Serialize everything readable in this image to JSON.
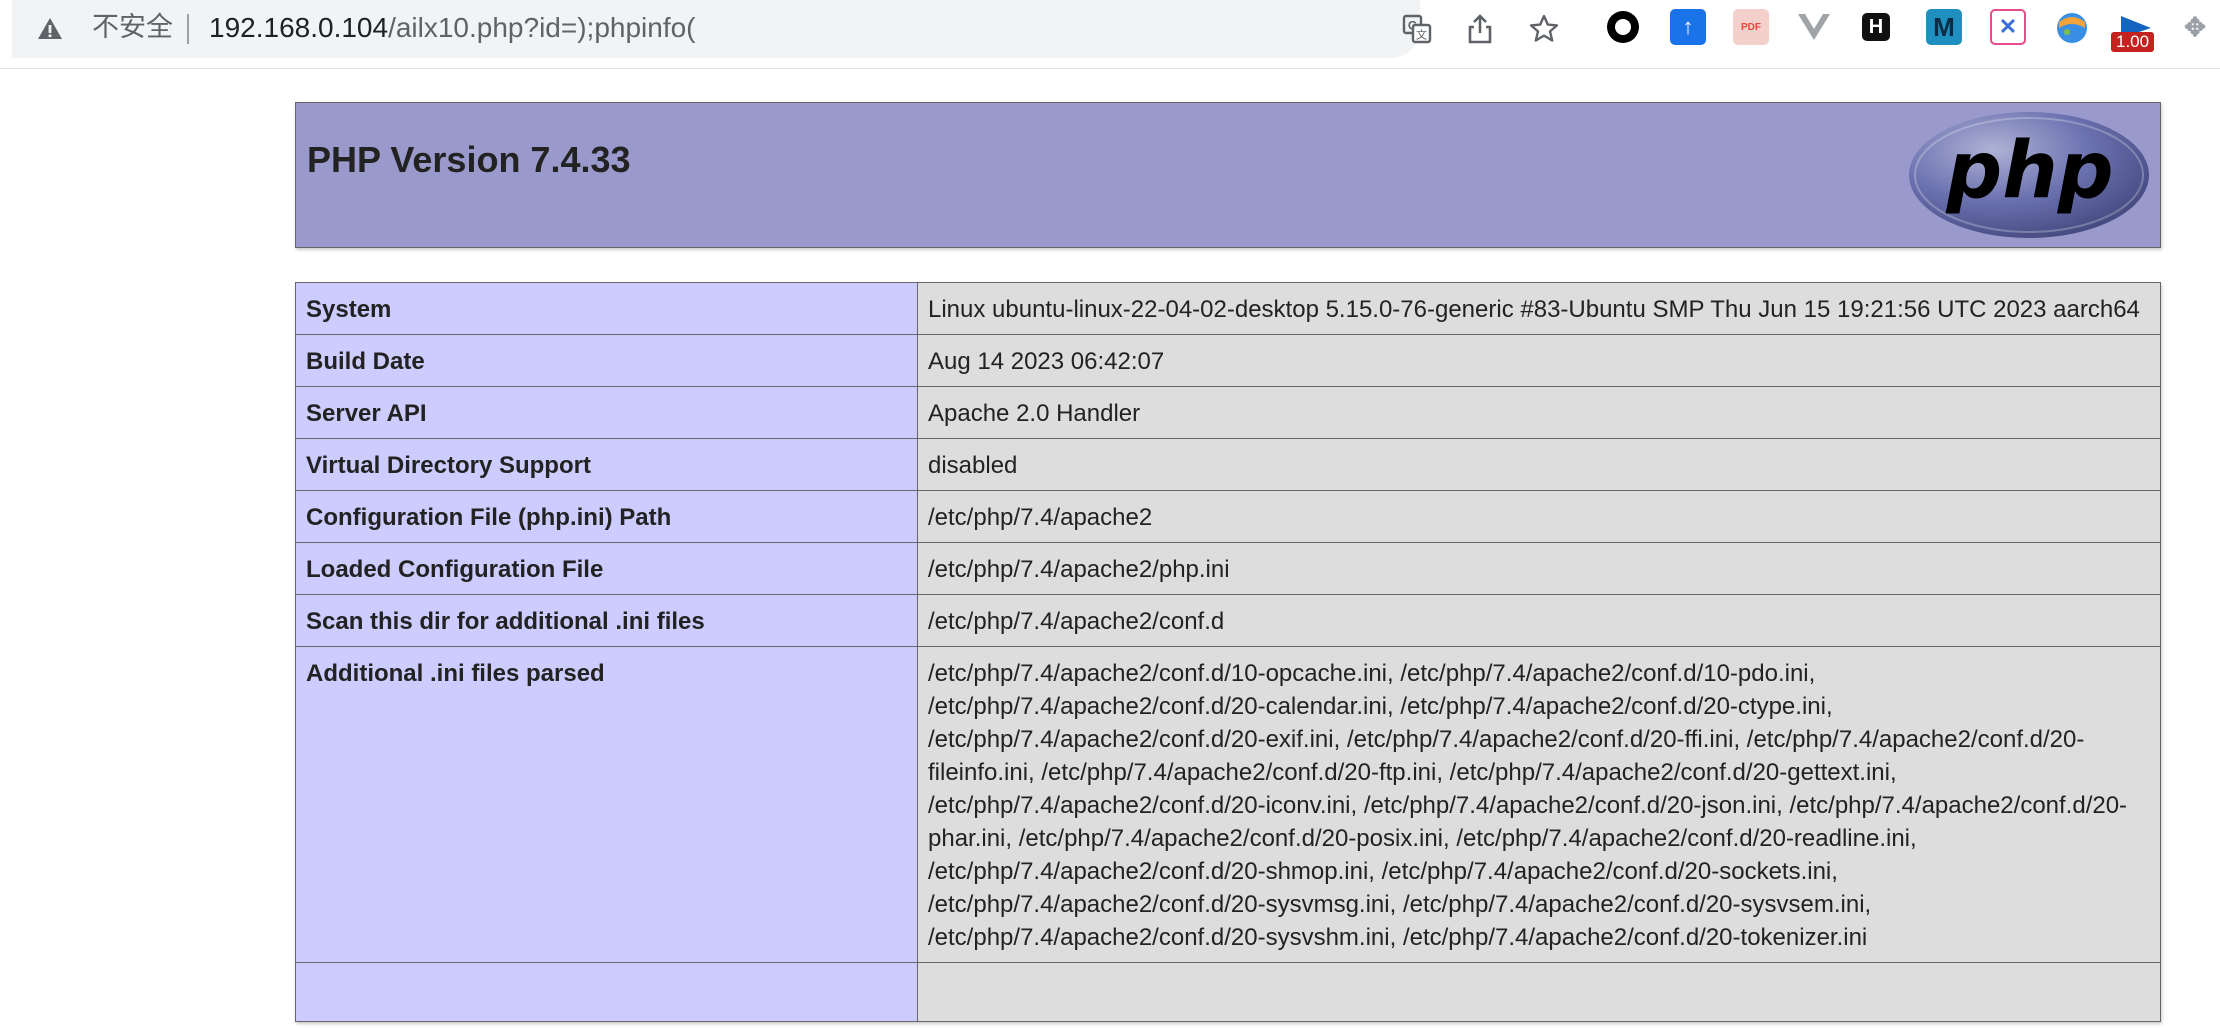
{
  "browser": {
    "security_label": "不安全",
    "url_host": "192.168.0.104",
    "url_path": "/ailx10.php?id=);phpinfo(",
    "actions": [
      "translate-icon",
      "share-icon",
      "bookmark-star-icon"
    ],
    "extensions": [
      {
        "name": "obs-extension-icon",
        "glyph": "",
        "color": "#000000"
      },
      {
        "name": "upload-extension-icon",
        "glyph": "↑",
        "color": "#1a73e8"
      },
      {
        "name": "pdf-extension-icon",
        "glyph": "PDF",
        "color": "#e8453c"
      },
      {
        "name": "vue-extension-icon",
        "glyph": "V",
        "color": "#9aa0a6"
      },
      {
        "name": "h-extension-icon",
        "glyph": "H",
        "color": "#111111"
      },
      {
        "name": "m-extension-icon",
        "glyph": "M",
        "color": "#1f8fbf"
      },
      {
        "name": "x-extension-icon",
        "glyph": "✕",
        "color": "#e84d8a"
      },
      {
        "name": "globe-extension-icon",
        "glyph": "◕",
        "color": "#f2a33a"
      },
      {
        "name": "speed-extension-icon",
        "glyph": "▶",
        "color": "#1565c0"
      },
      {
        "name": "puzzle-extension-icon",
        "glyph": "✥",
        "color": "#9aa0a6"
      }
    ],
    "speed_badge": "1.00"
  },
  "page": {
    "title": "PHP Version 7.4.33",
    "logo_text": "php"
  },
  "info_rows": [
    {
      "key": "System",
      "value": "Linux ubuntu-linux-22-04-02-desktop 5.15.0-76-generic #83-Ubuntu SMP Thu Jun 15 19:21:56 UTC 2023 aarch64"
    },
    {
      "key": "Build Date",
      "value": "Aug 14 2023 06:42:07"
    },
    {
      "key": "Server API",
      "value": "Apache 2.0 Handler"
    },
    {
      "key": "Virtual Directory Support",
      "value": "disabled"
    },
    {
      "key": "Configuration File (php.ini) Path",
      "value": "/etc/php/7.4/apache2"
    },
    {
      "key": "Loaded Configuration File",
      "value": "/etc/php/7.4/apache2/php.ini"
    },
    {
      "key": "Scan this dir for additional .ini files",
      "value": "/etc/php/7.4/apache2/conf.d"
    },
    {
      "key": "Additional .ini files parsed",
      "value": "/etc/php/7.4/apache2/conf.d/10-opcache.ini, /etc/php/7.4/apache2/conf.d/10-pdo.ini, /etc/php/7.4/apache2/conf.d/20-calendar.ini, /etc/php/7.4/apache2/conf.d/20-ctype.ini, /etc/php/7.4/apache2/conf.d/20-exif.ini, /etc/php/7.4/apache2/conf.d/20-ffi.ini, /etc/php/7.4/apache2/conf.d/20-fileinfo.ini, /etc/php/7.4/apache2/conf.d/20-ftp.ini, /etc/php/7.4/apache2/conf.d/20-gettext.ini, /etc/php/7.4/apache2/conf.d/20-iconv.ini, /etc/php/7.4/apache2/conf.d/20-json.ini, /etc/php/7.4/apache2/conf.d/20-phar.ini, /etc/php/7.4/apache2/conf.d/20-posix.ini, /etc/php/7.4/apache2/conf.d/20-readline.ini, /etc/php/7.4/apache2/conf.d/20-shmop.ini, /etc/php/7.4/apache2/conf.d/20-sockets.ini, /etc/php/7.4/apache2/conf.d/20-sysvmsg.ini, /etc/php/7.4/apache2/conf.d/20-sysvsem.ini, /etc/php/7.4/apache2/conf.d/20-sysvshm.ini, /etc/php/7.4/apache2/conf.d/20-tokenizer.ini"
    },
    {
      "key": "",
      "value": ""
    }
  ]
}
